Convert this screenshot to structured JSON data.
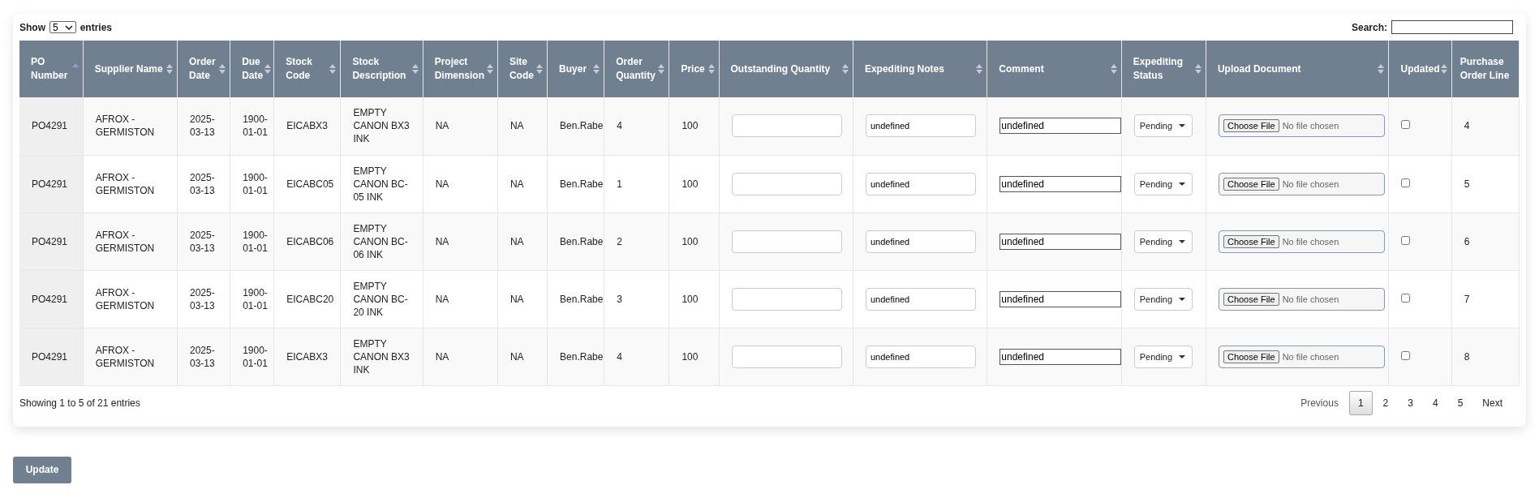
{
  "length_menu": {
    "prefix": "Show",
    "value": "5",
    "suffix": "entries"
  },
  "search": {
    "label": "Search:"
  },
  "table": {
    "columns": [
      {
        "label": "PO Number",
        "sorted": true
      },
      {
        "label": "Supplier Name",
        "sorted": false
      },
      {
        "label": "Order Date",
        "sorted": false
      },
      {
        "label": "Due Date",
        "sorted": false
      },
      {
        "label": "Stock Code",
        "sorted": false
      },
      {
        "label": "Stock Description",
        "sorted": false
      },
      {
        "label": "Project Dimension",
        "sorted": false
      },
      {
        "label": "Site Code",
        "sorted": false
      },
      {
        "label": "Buyer",
        "sorted": false
      },
      {
        "label": "Order Quantity",
        "sorted": false
      },
      {
        "label": "Price",
        "sorted": false
      },
      {
        "label": "Outstanding Quantity",
        "sorted": false
      },
      {
        "label": "Expediting Notes",
        "sorted": false
      },
      {
        "label": "Comment",
        "sorted": false
      },
      {
        "label": "Expediting Status",
        "sorted": false
      },
      {
        "label": "Upload Document",
        "sorted": false
      },
      {
        "label": "Updated",
        "sorted": false
      },
      {
        "label": "Purchase Order Line"
      }
    ],
    "rows": [
      {
        "po_number": "PO4291",
        "supplier_name": "AFROX - GERMISTON",
        "order_date": "2025-03-13",
        "due_date": "1900-01-01",
        "stock_code": "EICABX3",
        "stock_description": "EMPTY CANON BX3 INK",
        "project_dimension": "NA",
        "site_code": "NA",
        "buyer": "Ben.Rabe",
        "order_quantity": "4",
        "price": "100",
        "expediting_notes": "undefined",
        "comment": "undefined",
        "expediting_status": "Pending",
        "upload_button": "Choose File",
        "upload_status": "No file chosen",
        "updated": false,
        "purchase_order_line": "4"
      },
      {
        "po_number": "PO4291",
        "supplier_name": "AFROX - GERMISTON",
        "order_date": "2025-03-13",
        "due_date": "1900-01-01",
        "stock_code": "EICABC05",
        "stock_description": "EMPTY CANON BC-05 INK",
        "project_dimension": "NA",
        "site_code": "NA",
        "buyer": "Ben.Rabe",
        "order_quantity": "1",
        "price": "100",
        "expediting_notes": "undefined",
        "comment": "undefined",
        "expediting_status": "Pending",
        "upload_button": "Choose File",
        "upload_status": "No file chosen",
        "updated": false,
        "purchase_order_line": "5"
      },
      {
        "po_number": "PO4291",
        "supplier_name": "AFROX - GERMISTON",
        "order_date": "2025-03-13",
        "due_date": "1900-01-01",
        "stock_code": "EICABC06",
        "stock_description": "EMPTY CANON BC-06 INK",
        "project_dimension": "NA",
        "site_code": "NA",
        "buyer": "Ben.Rabe",
        "order_quantity": "2",
        "price": "100",
        "expediting_notes": "undefined",
        "comment": "undefined",
        "expediting_status": "Pending",
        "upload_button": "Choose File",
        "upload_status": "No file chosen",
        "updated": false,
        "purchase_order_line": "6"
      },
      {
        "po_number": "PO4291",
        "supplier_name": "AFROX - GERMISTON",
        "order_date": "2025-03-13",
        "due_date": "1900-01-01",
        "stock_code": "EICABC20",
        "stock_description": "EMPTY CANON BC-20 INK",
        "project_dimension": "NA",
        "site_code": "NA",
        "buyer": "Ben.Rabe",
        "order_quantity": "3",
        "price": "100",
        "expediting_notes": "undefined",
        "comment": "undefined",
        "expediting_status": "Pending",
        "upload_button": "Choose File",
        "upload_status": "No file chosen",
        "updated": false,
        "purchase_order_line": "7"
      },
      {
        "po_number": "PO4291",
        "supplier_name": "AFROX - GERMISTON",
        "order_date": "2025-03-13",
        "due_date": "1900-01-01",
        "stock_code": "EICABX3",
        "stock_description": "EMPTY CANON BX3 INK",
        "project_dimension": "NA",
        "site_code": "NA",
        "buyer": "Ben.Rabe",
        "order_quantity": "4",
        "price": "100",
        "expediting_notes": "undefined",
        "comment": "undefined",
        "expediting_status": "Pending",
        "upload_button": "Choose File",
        "upload_status": "No file chosen",
        "updated": false,
        "purchase_order_line": "8"
      }
    ]
  },
  "info": "Showing 1 to 5 of 21 entries",
  "pagination": {
    "previous": "Previous",
    "pages": [
      {
        "label": "1",
        "selected": true
      },
      {
        "label": "2",
        "selected": false
      },
      {
        "label": "3",
        "selected": false
      },
      {
        "label": "4",
        "selected": false
      },
      {
        "label": "5",
        "selected": false
      }
    ],
    "next": "Next"
  },
  "update_button": "Update"
}
